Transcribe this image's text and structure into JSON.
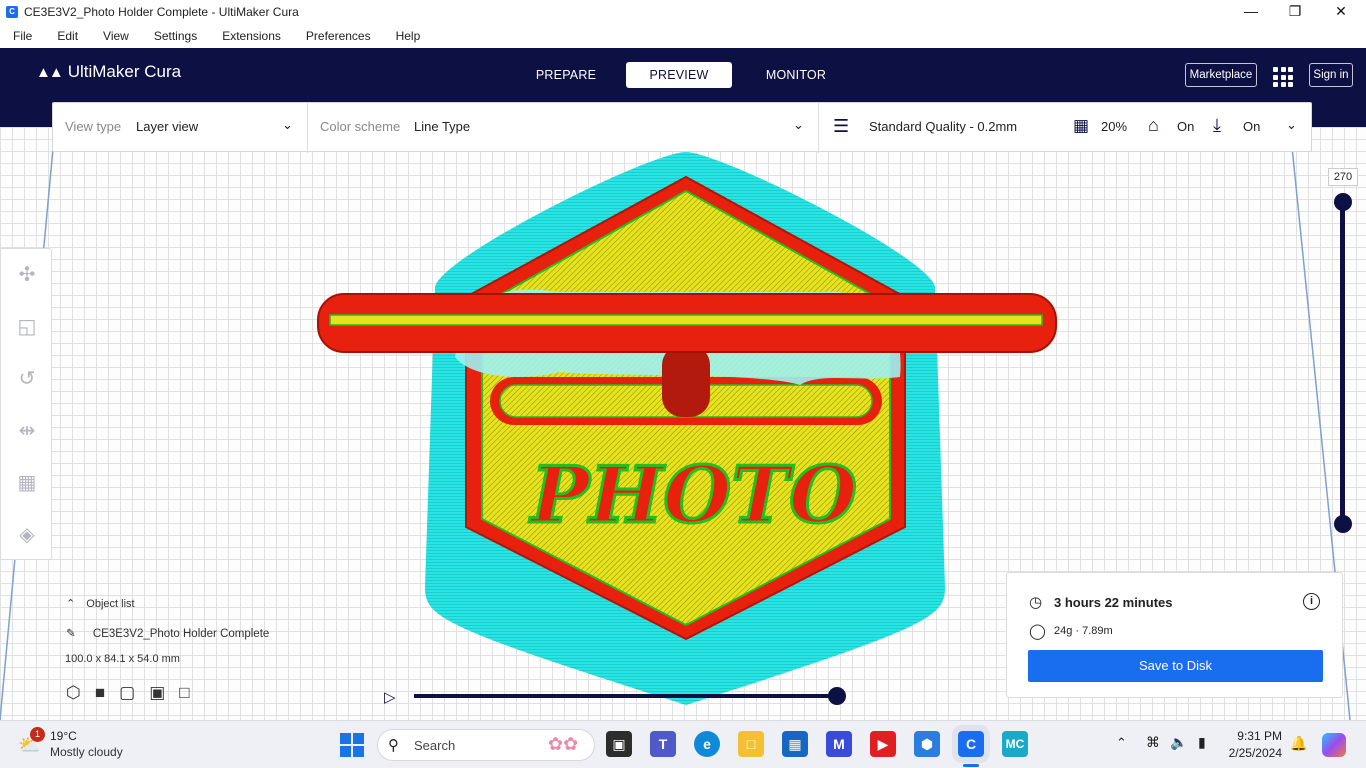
{
  "window": {
    "title": "CE3E3V2_Photo Holder Complete - UltiMaker Cura"
  },
  "menu": [
    "File",
    "Edit",
    "View",
    "Settings",
    "Extensions",
    "Preferences",
    "Help"
  ],
  "header": {
    "logo": "UltiMaker Cura",
    "tabs": [
      "PREPARE",
      "PREVIEW",
      "MONITOR"
    ],
    "active_tab": "PREVIEW",
    "marketplace": "Marketplace",
    "sign_in": "Sign in"
  },
  "view": {
    "view_type_label": "View type",
    "view_type_value": "Layer view",
    "color_scheme_label": "Color scheme",
    "color_scheme_value": "Line Type",
    "profile": "Standard Quality - 0.2mm",
    "infill": "20%",
    "support": "On",
    "adhesion": "On"
  },
  "object": {
    "list_label": "Object list",
    "name": "CE3E3V2_Photo Holder Complete",
    "dimensions": "100.0 x 84.1 x 54.0 mm",
    "model_text": "PHOTO"
  },
  "layer": {
    "current": "270"
  },
  "print": {
    "time": "3 hours 22 minutes",
    "material": "24g · 7.89m",
    "save_label": "Save to Disk"
  },
  "taskbar": {
    "weather_temp": "19°C",
    "weather_desc": "Mostly cloudy",
    "weather_badge": "1",
    "search": "Search",
    "time": "9:31 PM",
    "date": "2/25/2024"
  },
  "colors": {
    "header": "#0d1043",
    "accent": "#196ef0",
    "skirt": "#1fe0e0",
    "wall": "#e8200e",
    "infill": "#e6e31d",
    "inner_wall": "#20c020"
  }
}
